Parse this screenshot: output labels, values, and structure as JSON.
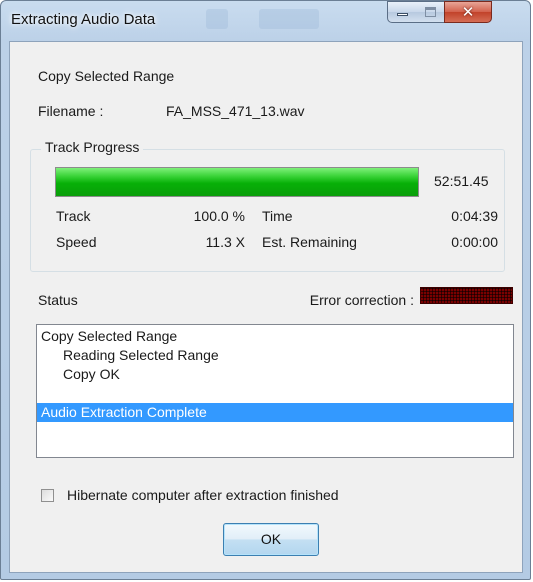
{
  "window": {
    "title": "Extracting Audio Data"
  },
  "info": {
    "mode": "Copy Selected Range",
    "filename_label": "Filename :",
    "filename_value": "FA_MSS_471_13.wav"
  },
  "track_progress": {
    "group_title": "Track Progress",
    "progress_fraction": 1.0,
    "elapsed": "52:51.45",
    "track_label": "Track",
    "track_value": "100.0 %",
    "time_label": "Time",
    "time_value": "0:04:39",
    "speed_label": "Speed",
    "speed_value": "11.3 X",
    "remaining_label": "Est. Remaining",
    "remaining_value": "0:00:00"
  },
  "status": {
    "label": "Status",
    "error_correction_label": "Error correction :",
    "log": [
      {
        "text": "Copy Selected Range",
        "indent": false,
        "selected": false
      },
      {
        "text": "Reading Selected Range",
        "indent": true,
        "selected": false
      },
      {
        "text": "Copy OK",
        "indent": true,
        "selected": false
      },
      {
        "text": "",
        "indent": false,
        "selected": false
      },
      {
        "text": "Audio Extraction Complete",
        "indent": false,
        "selected": true
      }
    ]
  },
  "options": {
    "hibernate_label": "Hibernate computer after extraction finished",
    "hibernate_checked": false
  },
  "buttons": {
    "ok_label": "OK"
  },
  "colors": {
    "progress_green": "#07b007",
    "selection_blue": "#3399ff",
    "error_indicator": "#7a0000"
  }
}
